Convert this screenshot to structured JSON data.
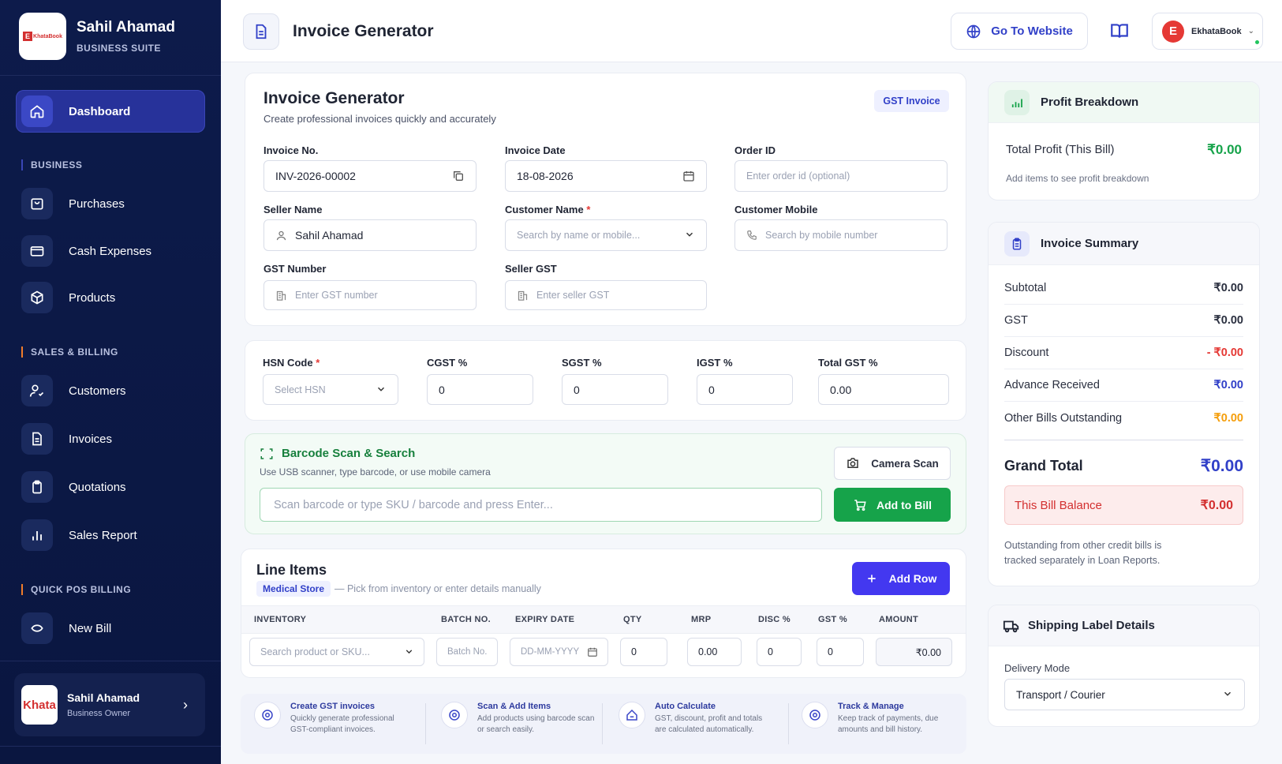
{
  "sidebar": {
    "brand_name": "Sahil Ahamad",
    "brand_sub": "BUSINESS SUITE",
    "logo_letter": "E",
    "logo_text": "KhataBook",
    "items": [
      {
        "label": "Dashboard",
        "active": true
      },
      {
        "label": "Purchases"
      },
      {
        "label": "Cash Expenses"
      },
      {
        "label": "Products"
      },
      {
        "label": "Customers"
      },
      {
        "label": "Invoices"
      },
      {
        "label": "Quotations"
      },
      {
        "label": "Sales Report"
      },
      {
        "label": "New Bill"
      }
    ],
    "sections": [
      "BUSINESS",
      "SALES & BILLING",
      "QUICK POS BILLING"
    ],
    "user": {
      "logo": "Khata",
      "name": "Sahil Ahamad",
      "role": "Business Owner"
    }
  },
  "header": {
    "title": "Invoice Generator",
    "website_btn": "Go To Website",
    "account_letter": "E",
    "account_name": "EkhataBook"
  },
  "invoice": {
    "title": "Invoice Generator",
    "subtitle": "Create professional invoices quickly and accurately",
    "badge": "GST Invoice",
    "fields": {
      "invoice_no_label": "Invoice No.",
      "invoice_no": "INV-2026-00002",
      "date_label": "Invoice Date",
      "date": "18-08-2026",
      "order_label": "Order ID",
      "order_ph": "Enter order id (optional)",
      "seller_label": "Seller Name",
      "seller": "Sahil Ahamad",
      "customer_label": "Customer Name",
      "customer_ph": "Search by name or mobile...",
      "mobile_label": "Customer Mobile",
      "mobile_ph": "Search by mobile number",
      "gst_label": "GST Number",
      "gst_ph": "Enter GST number",
      "seller_gst_label": "Seller GST",
      "seller_gst_ph": "Enter seller GST"
    }
  },
  "tax": {
    "hsn_label": "HSN Code",
    "hsn_ph": "Select HSN",
    "cgst_label": "CGST %",
    "cgst": "0",
    "sgst_label": "SGST %",
    "sgst": "0",
    "igst_label": "IGST %",
    "igst": "0",
    "total_label": "Total GST %",
    "total": "0.00"
  },
  "barcode": {
    "title": "Barcode Scan & Search",
    "sub": "Use USB scanner, type barcode, or use mobile camera",
    "placeholder": "Scan barcode or type SKU / barcode and press Enter...",
    "camera_btn": "Camera Scan",
    "add_btn": "Add to Bill"
  },
  "line_items": {
    "title": "Line Items",
    "badge": "Medical Store",
    "desc": "— Pick from inventory or enter details manually",
    "add_btn": "Add Row",
    "columns": [
      "INVENTORY",
      "BATCH NO.",
      "EXPIRY DATE",
      "QTY",
      "MRP",
      "DISC %",
      "GST %",
      "AMOUNT"
    ],
    "row": {
      "inventory_ph": "Search product or SKU...",
      "batch_ph": "Batch No.",
      "expiry_ph": "DD-MM-YYYY",
      "qty": "0",
      "mrp": "0.00",
      "disc": "0",
      "gst": "0",
      "amount": "₹0.00"
    }
  },
  "features": [
    {
      "title": "Create GST invoices",
      "desc": "Quickly generate professional GST-compliant invoices."
    },
    {
      "title": "Scan & Add Items",
      "desc": "Add products using barcode scan or search easily."
    },
    {
      "title": "Auto Calculate",
      "desc": "GST, discount, profit and totals are calculated automatically."
    },
    {
      "title": "Track & Manage",
      "desc": "Keep track of payments, due amounts and bill history."
    }
  ],
  "profit": {
    "title": "Profit Breakdown",
    "label": "Total Profit (This Bill)",
    "value": "₹0.00",
    "hint": "Add items to see profit breakdown"
  },
  "summary": {
    "title": "Invoice Summary",
    "rows": [
      {
        "label": "Subtotal",
        "value": "₹0.00"
      },
      {
        "label": "GST",
        "value": "₹0.00"
      },
      {
        "label": "Discount",
        "value": "- ₹0.00"
      },
      {
        "label": "Advance Received",
        "value": "₹0.00"
      },
      {
        "label": "Other Bills Outstanding",
        "value": "₹0.00"
      }
    ],
    "grand_label": "Grand Total",
    "grand_value": "₹0.00",
    "balance_label": "This Bill Balance",
    "balance_value": "₹0.00",
    "note": "Outstanding from other credit bills is tracked separately in Loan Reports."
  },
  "shipping": {
    "title": "Shipping Label Details",
    "mode_label": "Delivery Mode",
    "mode": "Transport / Courier"
  },
  "colors": {
    "accent": "#3140c8",
    "success": "#16a34a",
    "danger": "#e53935",
    "warning": "#f59e0b",
    "sidebar": "#0d1b4b"
  }
}
